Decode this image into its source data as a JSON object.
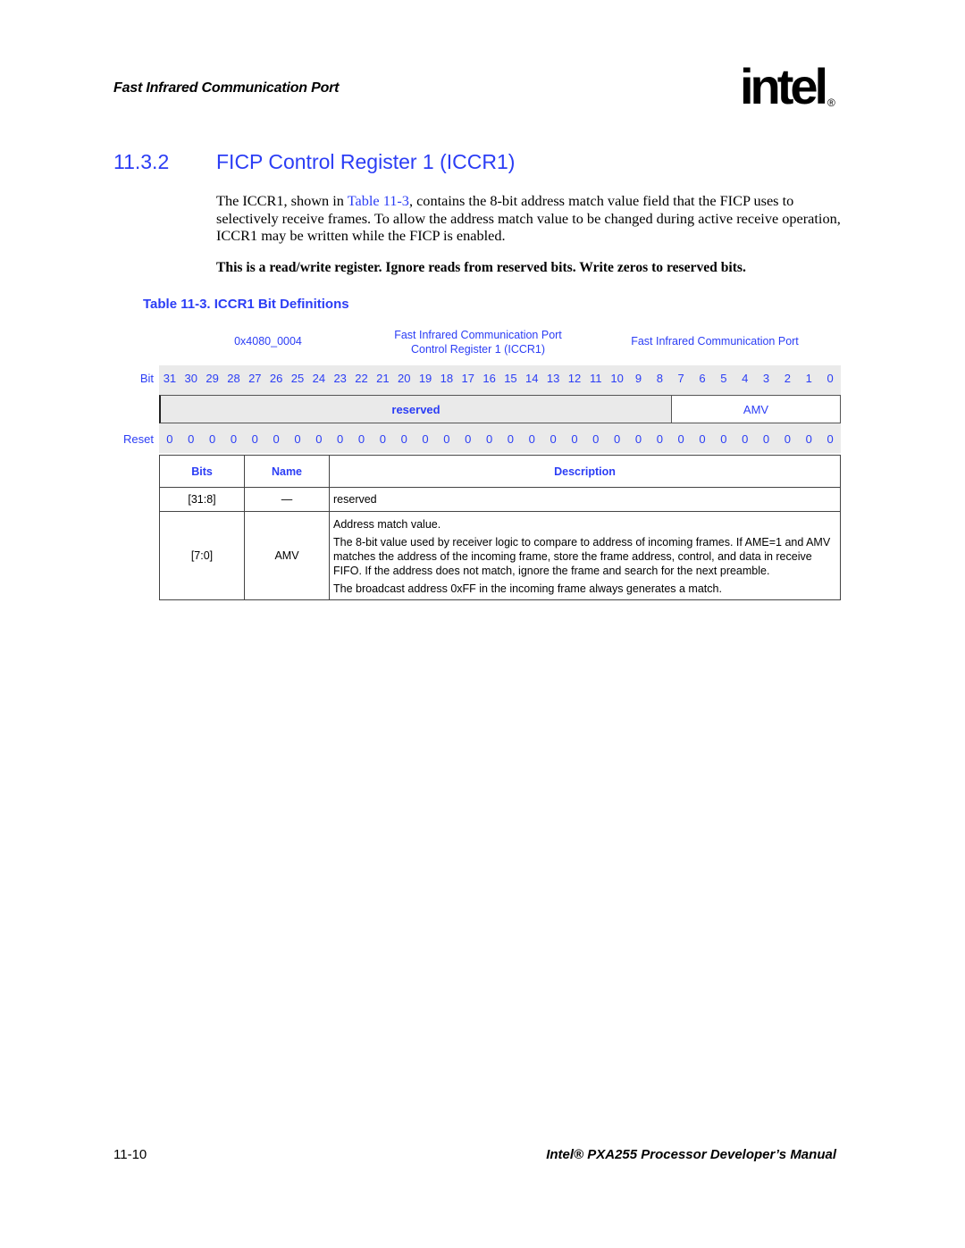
{
  "header": {
    "running_head": "Fast Infrared Communication Port",
    "logo_text": "intel",
    "logo_reg": "®"
  },
  "section": {
    "number": "11.3.2",
    "title": "FICP Control Register 1 (ICCR1)"
  },
  "body": {
    "para_pre": "The ICCR1, shown in ",
    "para_link": "Table 11-3",
    "para_post": ", contains the 8-bit address match value field that the FICP uses to selectively receive frames. To allow the address match value to be changed during active receive operation, ICCR1 may be written while the FICP is enabled.",
    "bold_note": "This is a read/write register. Ignore reads from reserved bits. Write zeros to reserved bits."
  },
  "table": {
    "title": "Table 11-3. ICCR1 Bit Definitions",
    "address": "0x4080_0004",
    "register_name_line1": "Fast Infrared Communication Port",
    "register_name_line2": "Control Register 1 (ICCR1)",
    "unit": "Fast Infrared Communication Port",
    "bit_label": "Bit",
    "reset_label": "Reset",
    "bits": [
      "31",
      "30",
      "29",
      "28",
      "27",
      "26",
      "25",
      "24",
      "23",
      "22",
      "21",
      "20",
      "19",
      "18",
      "17",
      "16",
      "15",
      "14",
      "13",
      "12",
      "11",
      "10",
      "9",
      "8",
      "7",
      "6",
      "5",
      "4",
      "3",
      "2",
      "1",
      "0"
    ],
    "reset_values": [
      "0",
      "0",
      "0",
      "0",
      "0",
      "0",
      "0",
      "0",
      "0",
      "0",
      "0",
      "0",
      "0",
      "0",
      "0",
      "0",
      "0",
      "0",
      "0",
      "0",
      "0",
      "0",
      "0",
      "0",
      "0",
      "0",
      "0",
      "0",
      "0",
      "0",
      "0",
      "0"
    ],
    "fields": {
      "reserved": "reserved",
      "amv": "AMV"
    },
    "columns": {
      "bits": "Bits",
      "name": "Name",
      "description": "Description"
    },
    "rows": [
      {
        "bits": "[31:8]",
        "name": "—",
        "description": [
          "reserved"
        ]
      },
      {
        "bits": "[7:0]",
        "name": "AMV",
        "description": [
          "Address match value.",
          "The 8-bit value used by receiver logic to compare to address of incoming frames. If AME=1 and AMV matches the address of the incoming frame, store the frame address, control, and data in receive FIFO. If the address does not match, ignore the frame and search for the next preamble.",
          "The broadcast address 0xFF in the incoming frame always generates a match."
        ]
      }
    ]
  },
  "footer": {
    "page_number": "11-10",
    "manual_title": "Intel® PXA255 Processor Developer’s Manual"
  }
}
